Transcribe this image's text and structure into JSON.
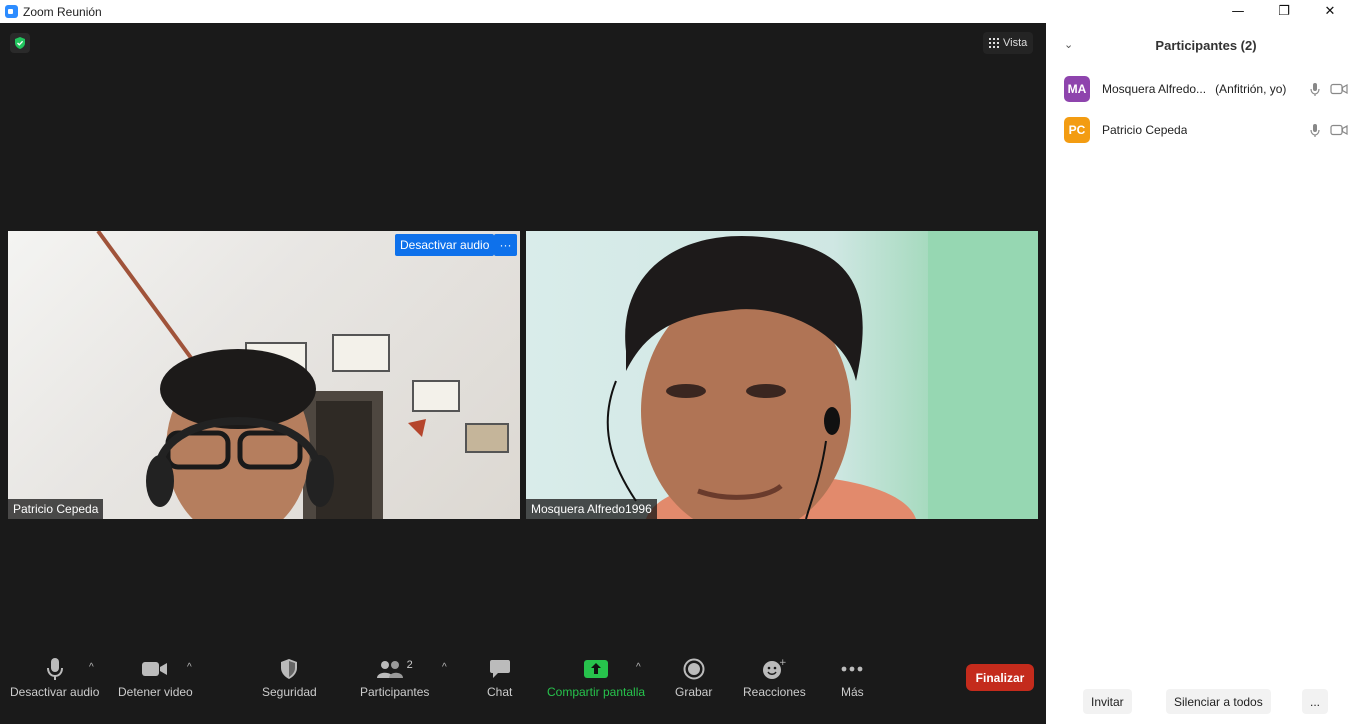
{
  "window": {
    "title": "Zoom Reunión",
    "controls": {
      "minimize": "—",
      "restore": "❐",
      "close": "✕"
    }
  },
  "meeting": {
    "view_label": "Vista",
    "tiles": [
      {
        "name": "Patricio Cepeda",
        "mute_button": "Desactivar audio",
        "more_button": "···"
      },
      {
        "name": "Mosquera Alfredo1996"
      }
    ]
  },
  "toolbar": {
    "mute": "Desactivar audio",
    "video": "Detener video",
    "security": "Seguridad",
    "participants": "Participantes",
    "participants_count": "2",
    "chat": "Chat",
    "share": "Compartir pantalla",
    "record": "Grabar",
    "reactions": "Reacciones",
    "more": "Más",
    "end": "Finalizar"
  },
  "participants_panel": {
    "title": "Participantes (2)",
    "list": [
      {
        "initials": "MA",
        "name": "Mosquera Alfredo...",
        "role": "(Anfitrión, yo)",
        "avatar_color": "#8e44ad"
      },
      {
        "initials": "PC",
        "name": "Patricio Cepeda",
        "role": "",
        "avatar_color": "#f39c12"
      }
    ],
    "invite": "Invitar",
    "mute_all": "Silenciar a todos",
    "more": "..."
  },
  "colors": {
    "accent": "#0e71eb",
    "share_green": "#27c24c",
    "end_red": "#c42b1c"
  }
}
